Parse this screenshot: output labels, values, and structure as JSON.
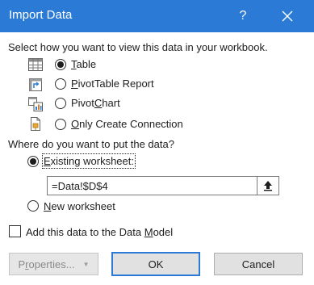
{
  "dialog": {
    "title": "Import Data",
    "help_glyph": "?"
  },
  "view_section": {
    "label": "Select how you want to view this data in your workbook.",
    "options": [
      {
        "pre": "",
        "key": "T",
        "post": "able",
        "icon": "table-icon",
        "selected": true
      },
      {
        "pre": "",
        "key": "P",
        "post": "ivotTable Report",
        "icon": "pivottable-icon",
        "selected": false
      },
      {
        "pre": "Pivot",
        "key": "C",
        "post": "hart",
        "icon": "pivotchart-icon",
        "selected": false
      },
      {
        "pre": "",
        "key": "O",
        "post": "nly Create Connection",
        "icon": "connection-icon",
        "selected": false
      }
    ]
  },
  "location_section": {
    "label": "Where do you want to put the data?",
    "existing": {
      "pre": "",
      "key": "E",
      "post": "xisting worksheet:",
      "selected": true
    },
    "reference_value": "=Data!$D$4",
    "new": {
      "pre": "",
      "key": "N",
      "post": "ew worksheet",
      "selected": false
    }
  },
  "data_model": {
    "pre": "Add this data to the Data ",
    "key": "M",
    "post": "odel",
    "checked": false
  },
  "buttons": {
    "properties": {
      "pre": "P",
      "key": "r",
      "post": "operties...",
      "caret": "▼"
    },
    "ok": "OK",
    "cancel": "Cancel"
  },
  "colors": {
    "titlebar": "#2b7ad6",
    "default_button_border": "#2b7ad6"
  }
}
